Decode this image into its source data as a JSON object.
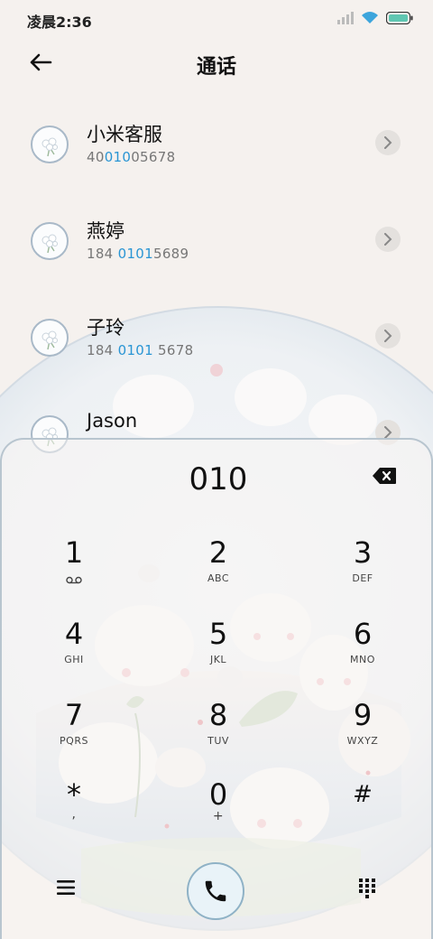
{
  "status": {
    "time": "凌晨2:36"
  },
  "header": {
    "title": "通话"
  },
  "contacts": [
    {
      "name": "小米客服",
      "num_pre": "40",
      "num_hl": "010",
      "num_post": "05678"
    },
    {
      "name": "燕婷",
      "num_pre": "184 ",
      "num_hl": "0101",
      "num_post": "5689"
    },
    {
      "name": "子玲",
      "num_pre": "184 ",
      "num_hl": "0101",
      "num_post": " 5678"
    },
    {
      "name": "Jason",
      "num_pre": "",
      "num_hl": "",
      "num_post": ""
    }
  ],
  "dialer": {
    "number": "010",
    "keys": [
      {
        "digit": "1",
        "letters": ""
      },
      {
        "digit": "2",
        "letters": "ABC"
      },
      {
        "digit": "3",
        "letters": "DEF"
      },
      {
        "digit": "4",
        "letters": "GHI"
      },
      {
        "digit": "5",
        "letters": "JKL"
      },
      {
        "digit": "6",
        "letters": "MNO"
      },
      {
        "digit": "7",
        "letters": "PQRS"
      },
      {
        "digit": "8",
        "letters": "TUV"
      },
      {
        "digit": "9",
        "letters": "WXYZ"
      },
      {
        "digit": "*",
        "letters": ","
      },
      {
        "digit": "0",
        "letters": "+"
      },
      {
        "digit": "#",
        "letters": ""
      }
    ]
  },
  "icons": {
    "back": "arrow-left-icon",
    "chevron": "chevron-right-icon",
    "backspace": "backspace-icon",
    "voicemail": "voicemail-icon",
    "menu": "menu-icon",
    "call": "phone-icon",
    "keypad": "dialpad-icon"
  },
  "colors": {
    "highlight": "#2a95d4",
    "call_button_border": "#8fb2c6"
  }
}
